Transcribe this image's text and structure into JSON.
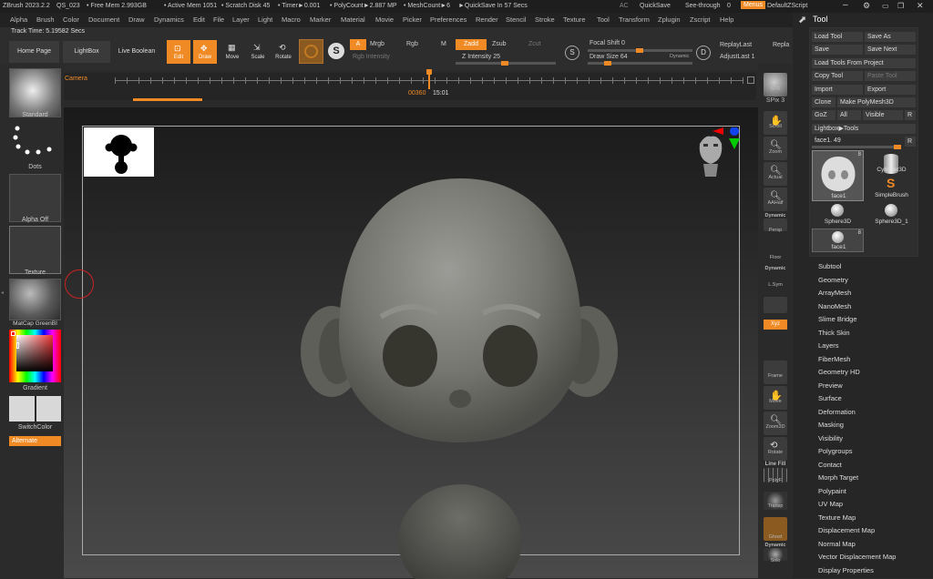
{
  "titlebar": {
    "app": "ZBrush 2023.2.2",
    "doc": "QS_023",
    "free_mem": "• Free Mem 2.993GB",
    "active_mem": "• Active Mem 1051",
    "scratch": "• Scratch Disk 45",
    "timer": "• Timer►0.001",
    "polycount": "• PolyCount►2.887 MP",
    "meshcount": "• MeshCount►6",
    "quicksave": "►QuickSave In 57 Secs",
    "ac": "AC",
    "quicksave_btn": "QuickSave",
    "seethrough": "See-through",
    "seethrough_val": "0",
    "menus": "Menus",
    "script": "DefaultZScript"
  },
  "menus": [
    "Alpha",
    "Brush",
    "Color",
    "Document",
    "Draw",
    "Dynamics",
    "Edit",
    "File",
    "Layer",
    "Light",
    "Macro",
    "Marker",
    "Material",
    "Movie",
    "Picker",
    "Preferences",
    "Render",
    "Stencil",
    "Stroke",
    "Texture",
    "Tool",
    "Transform",
    "Zplugin",
    "Zscript",
    "Help"
  ],
  "track_time": "Track Time: 5.19582 Secs",
  "toolbar": {
    "home": "Home Page",
    "lightbox": "LightBox",
    "liveboolean": "Live Boolean",
    "edit": "Edit",
    "draw": "Draw",
    "move": "Move",
    "scale": "Scale",
    "rotate": "Rotate",
    "a": "A",
    "mrgb": "Mrgb",
    "rgb": "Rgb",
    "m": "M",
    "rgb_intensity": "Rgb Intensity",
    "zadd": "Zadd",
    "zsub": "Zsub",
    "zcut": "Zcut",
    "z_intensity": "Z Intensity 25",
    "focal_shift": "Focal Shift 0",
    "draw_size": "Draw Size 64",
    "dynamic": "Dynamic",
    "replaylast": "ReplayLast",
    "replay": "Repla",
    "adjustlast": "AdjustLast 1",
    "s_icon": "S",
    "d_icon": "D"
  },
  "timeline": {
    "camera": "Camera",
    "time_label": "00360",
    "time_val": "15:01"
  },
  "leftshelf": {
    "standard": "Standard",
    "dots": "Dots",
    "alpha_off": "Alpha Off",
    "texture": "Texture",
    "matcap": "MatCap GreenBI",
    "gradient": "Gradient",
    "switchcolor": "SwitchColor",
    "alternate": "Alternate"
  },
  "rightshelf": {
    "bpr": "BPR",
    "spix": "SPix 3",
    "scroll": "Scroll",
    "zoom": "Zoom",
    "actual": "Actual",
    "aahalf": "AAHalf",
    "dynamic": "Dynamic",
    "persp": "Persp",
    "floor": "Floor",
    "dynamic2": "Dynamic",
    "lsym": "L.Sym",
    "xyz": "Xyz",
    "frame": "Frame",
    "move": "Move",
    "zoom3d": "Zoom3D",
    "rotate": "Rotate",
    "linefill": "Line Fill",
    "polyf": "PolyF",
    "transp": "Transp",
    "ghost": "Ghost",
    "dynamic3": "Dynamic",
    "solo": "Solo"
  },
  "toolpanel": {
    "title": "Tool",
    "load_tool": "Load Tool",
    "save_as": "Save As",
    "save": "Save",
    "save_next": "Save Next",
    "load_from_project": "Load Tools From Project",
    "copy_tool": "Copy Tool",
    "paste_tool": "Paste Tool",
    "import": "Import",
    "export": "Export",
    "clone": "Clone",
    "make_polymesh": "Make PolyMesh3D",
    "goz": "GoZ",
    "all": "All",
    "visible": "Visible",
    "r": "R",
    "lightbox_tools": "Lightbox▶Tools",
    "face1_slider": "face1. 49",
    "r2": "R",
    "tools": [
      {
        "name": "face1",
        "count": "8"
      },
      {
        "name": "Cylinder3D"
      },
      {
        "name": "SimpleBrush"
      },
      {
        "name": "Sphere3D"
      },
      {
        "name": "Sphere3D_1"
      },
      {
        "name": "face1",
        "count": "8"
      }
    ]
  },
  "submenus": [
    "Subtool",
    "Geometry",
    "ArrayMesh",
    "NanoMesh",
    "Slime Bridge",
    "Thick Skin",
    "Layers",
    "FiberMesh",
    "Geometry HD",
    "Preview",
    "Surface",
    "Deformation",
    "Masking",
    "Visibility",
    "Polygroups",
    "Contact",
    "Morph Target",
    "Polypaint",
    "UV Map",
    "Texture Map",
    "Displacement Map",
    "Normal Map",
    "Vector Displacement Map",
    "Display Properties"
  ]
}
